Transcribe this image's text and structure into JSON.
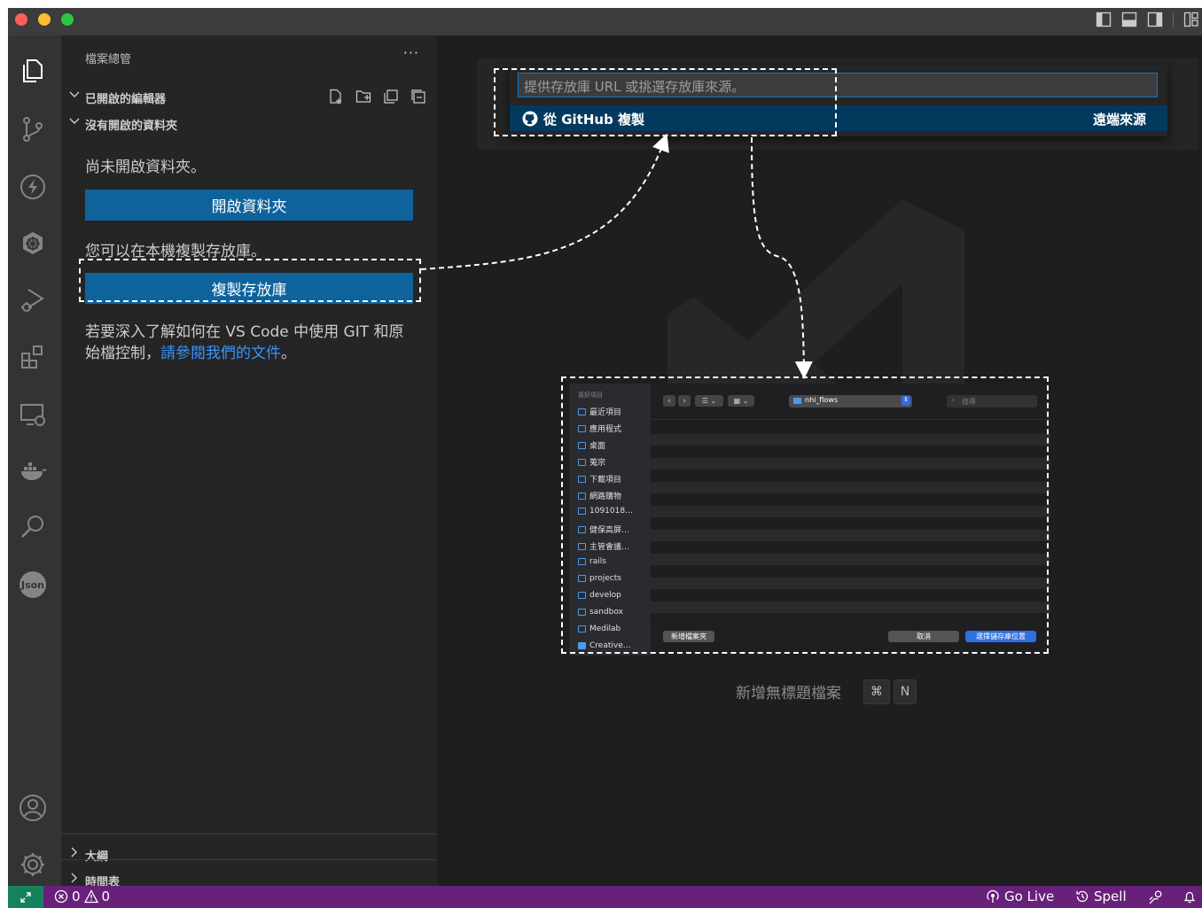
{
  "sidebar": {
    "title": "檔案總管",
    "more": "···",
    "open_editors": "已開啟的編輯器",
    "no_folder": "沒有開啟的資料夾",
    "no_folder_msg": "尚未開啟資料夾。",
    "open_folder_button": "開啟資料夾",
    "clone_msg": "您可以在本機複製存放庫。",
    "clone_button": "複製存放庫",
    "git_info_1": "若要深入了解如何在 VS Code 中使用 GIT 和原",
    "git_info_2": "始檔控制，",
    "git_info_link": "請參閱我們的文件",
    "git_info_end": "。",
    "outline": "大綱",
    "timeline": "時間表"
  },
  "quick_pick": {
    "placeholder": "提供存放庫 URL 或挑選存放庫來源。",
    "item_label": "從 GitHub 複製",
    "item_detail": "遠端來源"
  },
  "editor": {
    "hint_label": "新增無標題檔案",
    "key1": "⌘",
    "key2": "N"
  },
  "finder": {
    "section": "喜好項目",
    "items": [
      "最近項目",
      "應用程式",
      "桌面",
      "蒐宗",
      "下載項目",
      "網路購物",
      "1091018…",
      "健保高屏…",
      "主管會議…",
      "rails",
      "projects",
      "develop",
      "sandbox",
      "Medilab",
      "Creative…"
    ],
    "location": "nhi_flows",
    "search": "搜尋",
    "new_folder": "新增檔案夾",
    "cancel": "取消",
    "choose": "選擇儲存庫位置"
  },
  "status": {
    "errors": "0",
    "warnings": "0",
    "go_live": "Go Live",
    "spell": "Spell"
  },
  "colors": {
    "accent": "#0e639c",
    "status_bar": "#68217a",
    "remote": "#16825d",
    "selection": "#04395e"
  }
}
